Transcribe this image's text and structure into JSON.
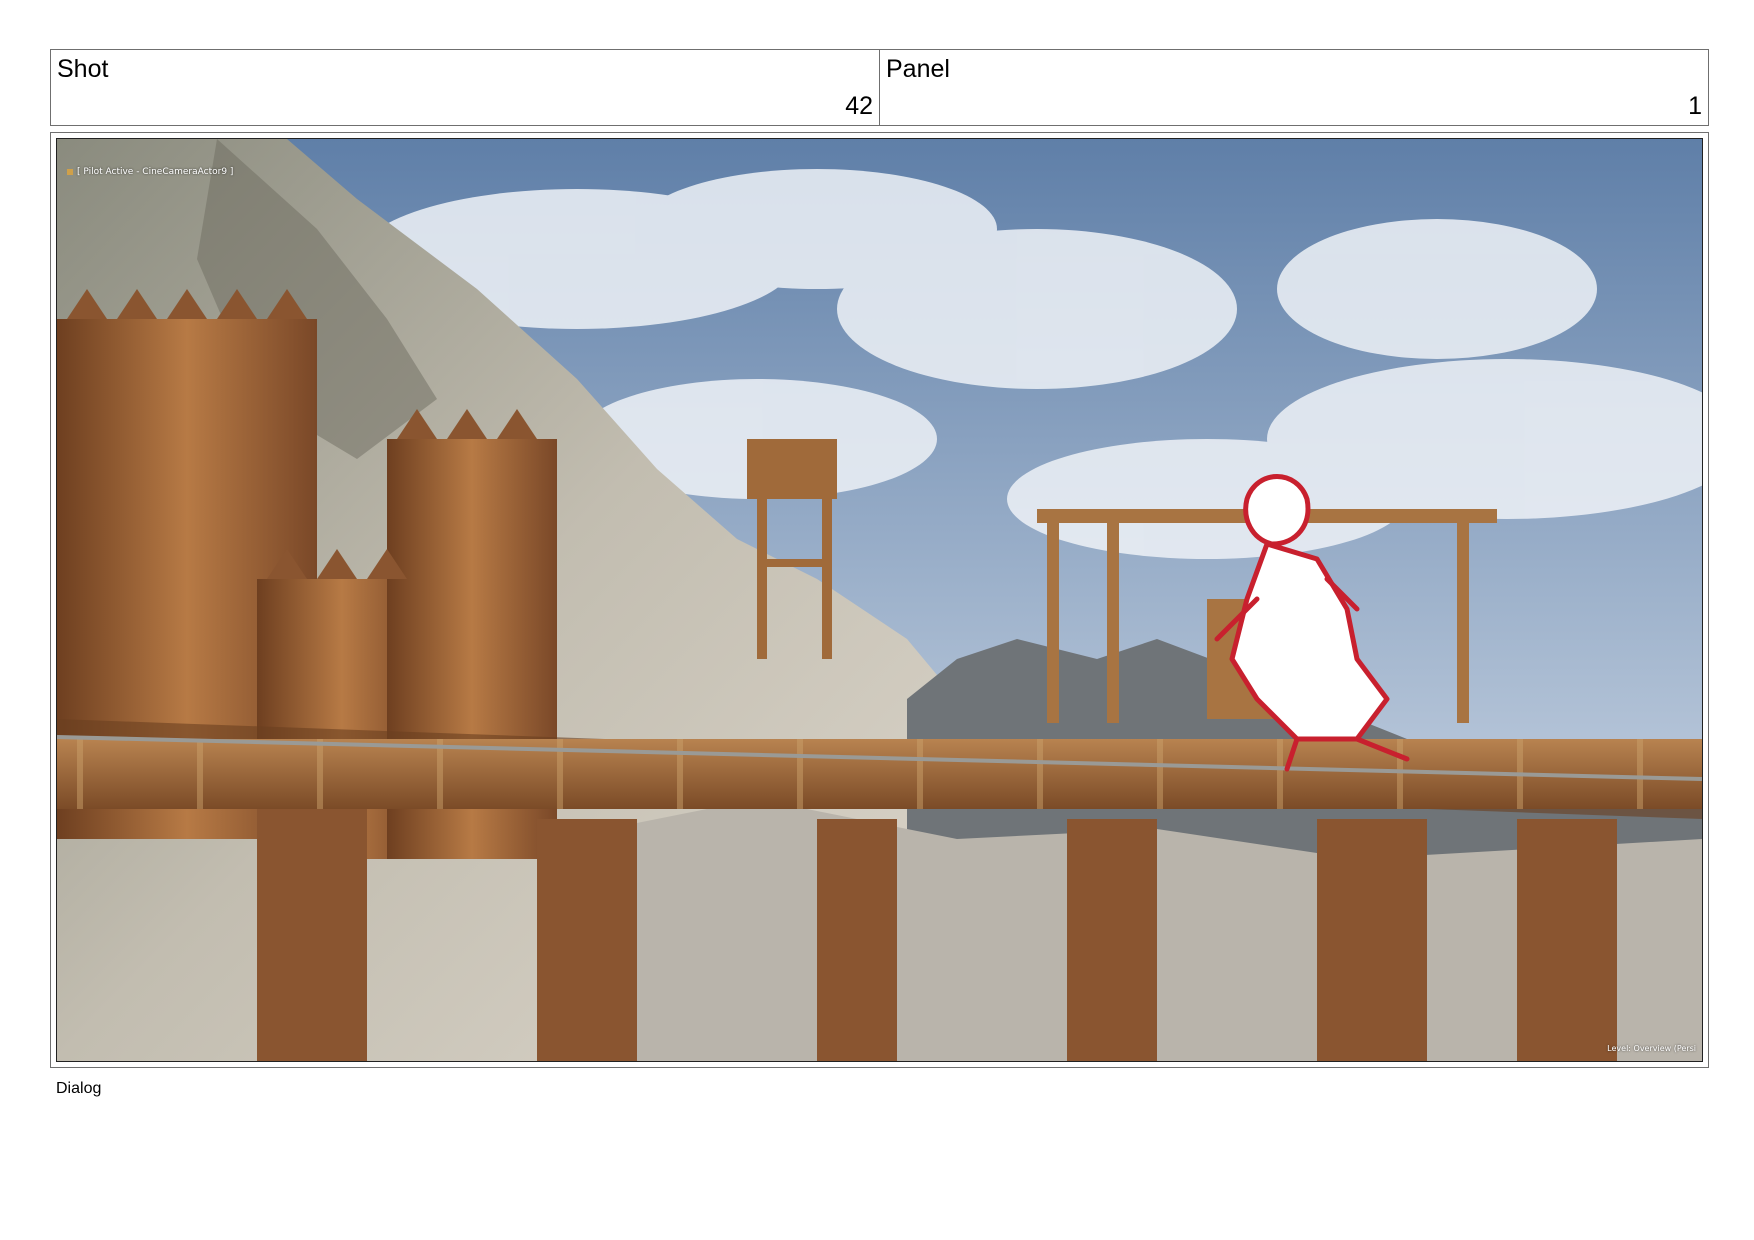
{
  "header": {
    "shot_label": "Shot",
    "shot_value": "42",
    "panel_label": "Panel",
    "panel_value": "1"
  },
  "frame": {
    "overlay_top_left": "[ Pilot Active - CineCameraActor9 ]",
    "overlay_bottom_right": "Level: Overview (Persi"
  },
  "dialog": {
    "label": "Dialog"
  },
  "colors": {
    "border": "#6f6f6f",
    "sketch": "#c8202e",
    "wood": "#8a5530"
  }
}
